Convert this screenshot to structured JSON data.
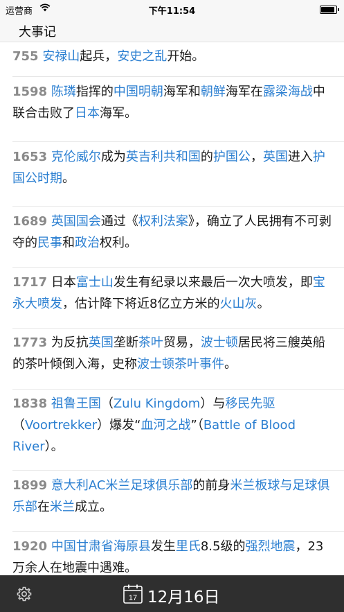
{
  "status_bar": {
    "carrier": "运营商",
    "time": "下午11:54",
    "battery_level": 0.9,
    "wifi_icon": "wifi-icon",
    "battery_icon": "battery-icon"
  },
  "nav": {
    "title": "大事记"
  },
  "events": [
    {
      "year": "755",
      "segments": [
        {
          "t": "安禄山",
          "link": true
        },
        {
          "t": "起兵，",
          "link": false
        },
        {
          "t": "安史之乱",
          "link": true
        },
        {
          "t": "开始。",
          "link": false
        }
      ]
    },
    {
      "year": "1598",
      "segments": [
        {
          "t": "陈璘",
          "link": true
        },
        {
          "t": "指挥的",
          "link": false
        },
        {
          "t": "中国明朝",
          "link": true
        },
        {
          "t": "海军和",
          "link": false
        },
        {
          "t": "朝鲜",
          "link": true
        },
        {
          "t": "海军在",
          "link": false
        },
        {
          "t": "露梁海战",
          "link": true
        },
        {
          "t": "中联合击败了",
          "link": false
        },
        {
          "t": "日本",
          "link": true
        },
        {
          "t": "海军。",
          "link": false
        }
      ]
    },
    {
      "year": "1653",
      "segments": [
        {
          "t": "克伦威尔",
          "link": true
        },
        {
          "t": "成为",
          "link": false
        },
        {
          "t": "英吉利共和国",
          "link": true
        },
        {
          "t": "的",
          "link": false
        },
        {
          "t": "护国公",
          "link": true
        },
        {
          "t": "，",
          "link": false
        },
        {
          "t": "英国",
          "link": true
        },
        {
          "t": "进入",
          "link": false
        },
        {
          "t": "护国公时期",
          "link": true
        },
        {
          "t": "。",
          "link": false
        }
      ]
    },
    {
      "year": "1689",
      "segments": [
        {
          "t": "英国国会",
          "link": true
        },
        {
          "t": "通过《",
          "link": false
        },
        {
          "t": "权利法案",
          "link": true
        },
        {
          "t": "》，确立了人民拥有不可剥夺的",
          "link": false
        },
        {
          "t": "民事",
          "link": true
        },
        {
          "t": "和",
          "link": false
        },
        {
          "t": "政治",
          "link": true
        },
        {
          "t": "权利。",
          "link": false
        }
      ]
    },
    {
      "year": "1717",
      "segments": [
        {
          "t": "日本",
          "link": false
        },
        {
          "t": "富士山",
          "link": true
        },
        {
          "t": "发生有纪录以来最后一次大喷发，即",
          "link": false
        },
        {
          "t": "宝永大喷发",
          "link": true
        },
        {
          "t": "，估计降下将近8亿立方米的",
          "link": false
        },
        {
          "t": "火山灰",
          "link": true
        },
        {
          "t": "。",
          "link": false
        }
      ]
    },
    {
      "year": "1773",
      "segments": [
        {
          "t": "为反抗",
          "link": false
        },
        {
          "t": "英国",
          "link": true
        },
        {
          "t": "垄断",
          "link": false
        },
        {
          "t": "茶叶",
          "link": true
        },
        {
          "t": "贸易，",
          "link": false
        },
        {
          "t": "波士顿",
          "link": true
        },
        {
          "t": "居民将三艘英船的茶叶倾倒入海，史称",
          "link": false
        },
        {
          "t": "波士顿茶叶事件",
          "link": true
        },
        {
          "t": "。",
          "link": false
        }
      ]
    },
    {
      "year": "1838",
      "segments": [
        {
          "t": "祖鲁王国",
          "link": true
        },
        {
          "t": "（",
          "link": false
        },
        {
          "t": "Zulu Kingdom",
          "link": true
        },
        {
          "t": "）与",
          "link": false
        },
        {
          "t": "移民先驱",
          "link": true
        },
        {
          "t": "（",
          "link": false
        },
        {
          "t": "Voortrekker",
          "link": true
        },
        {
          "t": "）爆发“",
          "link": false
        },
        {
          "t": "血河之战",
          "link": true
        },
        {
          "t": "”（",
          "link": false
        },
        {
          "t": "Battle of Blood River",
          "link": true
        },
        {
          "t": "）。",
          "link": false
        }
      ]
    },
    {
      "year": "1899",
      "segments": [
        {
          "t": "意大利AC米兰足球俱乐部",
          "link": true
        },
        {
          "t": "的前身",
          "link": false
        },
        {
          "t": "米兰板球与足球俱乐部",
          "link": true
        },
        {
          "t": "在",
          "link": false
        },
        {
          "t": "米兰",
          "link": true
        },
        {
          "t": "成立。",
          "link": false
        }
      ]
    },
    {
      "year": "1920",
      "segments": [
        {
          "t": "中国甘肃省海原县",
          "link": true
        },
        {
          "t": "发生",
          "link": false
        },
        {
          "t": "里氏",
          "link": true
        },
        {
          "t": "8.5级的",
          "link": false
        },
        {
          "t": "强烈地震",
          "link": true
        },
        {
          "t": "，23万余人在地震中遇难。",
          "link": false
        }
      ]
    }
  ],
  "bottom_bar": {
    "settings_icon": "gear-icon",
    "calendar_icon": "calendar-icon",
    "calendar_day": "17",
    "date": "12月16日"
  }
}
